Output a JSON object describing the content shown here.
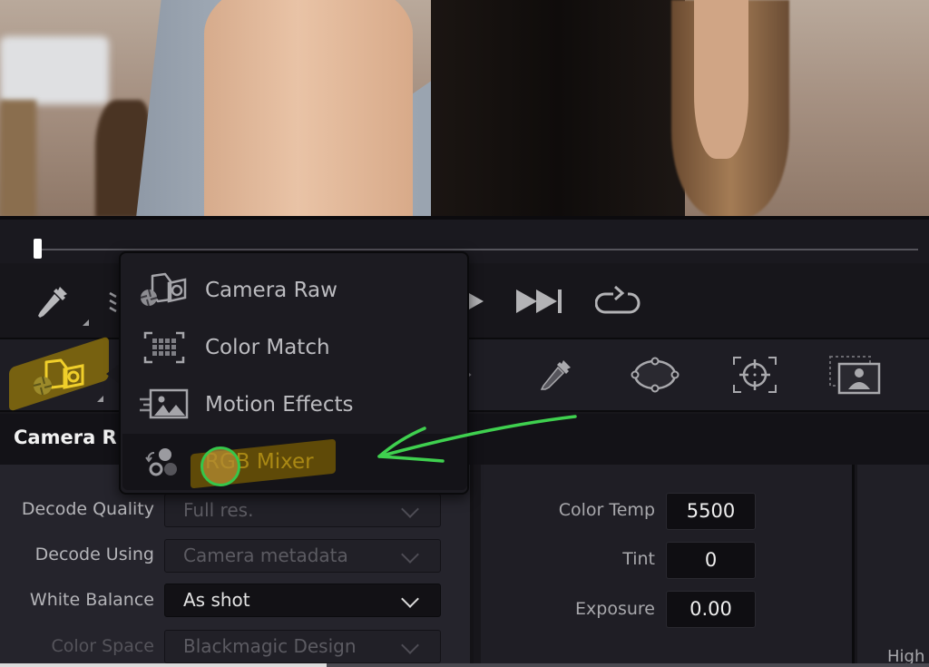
{
  "viewer": {
    "description": "video frame preview"
  },
  "scrubber": {
    "playhead_position": 0.0
  },
  "transport": {
    "buttons": [
      "eyedropper",
      "waveform",
      "play",
      "skip-to-end",
      "loop"
    ]
  },
  "palette": {
    "tools": [
      "camera-raw",
      "eyedropper",
      "power-window-circle",
      "tracker",
      "magic-mask"
    ],
    "active_tool": "camera-raw"
  },
  "popup_menu": {
    "items": [
      {
        "label": "Camera Raw",
        "icon": "camera-raw-icon"
      },
      {
        "label": "Color Match",
        "icon": "color-match-icon"
      },
      {
        "label": "Motion Effects",
        "icon": "motion-effects-icon"
      },
      {
        "label": "RGB Mixer",
        "icon": "rgb-mixer-icon",
        "highlighted": true
      }
    ]
  },
  "panel": {
    "title": "Camera R",
    "settings": [
      {
        "label": "Decode Quality",
        "value": "Full res.",
        "enabled": false
      },
      {
        "label": "Decode Using",
        "value": "Camera metadata",
        "enabled": false
      },
      {
        "label": "White Balance",
        "value": "As shot",
        "enabled": true
      },
      {
        "label": "Color Space",
        "value": "Blackmagic Design",
        "enabled": false
      }
    ],
    "numeric": [
      {
        "label": "Color Temp",
        "value": "5500"
      },
      {
        "label": "Tint",
        "value": "0"
      },
      {
        "label": "Exposure",
        "value": "0.00"
      }
    ],
    "right_label": "High"
  },
  "colors": {
    "accent_yellow": "#e9c33a",
    "annotation_green": "#3fd04f",
    "background": "#17161b"
  }
}
